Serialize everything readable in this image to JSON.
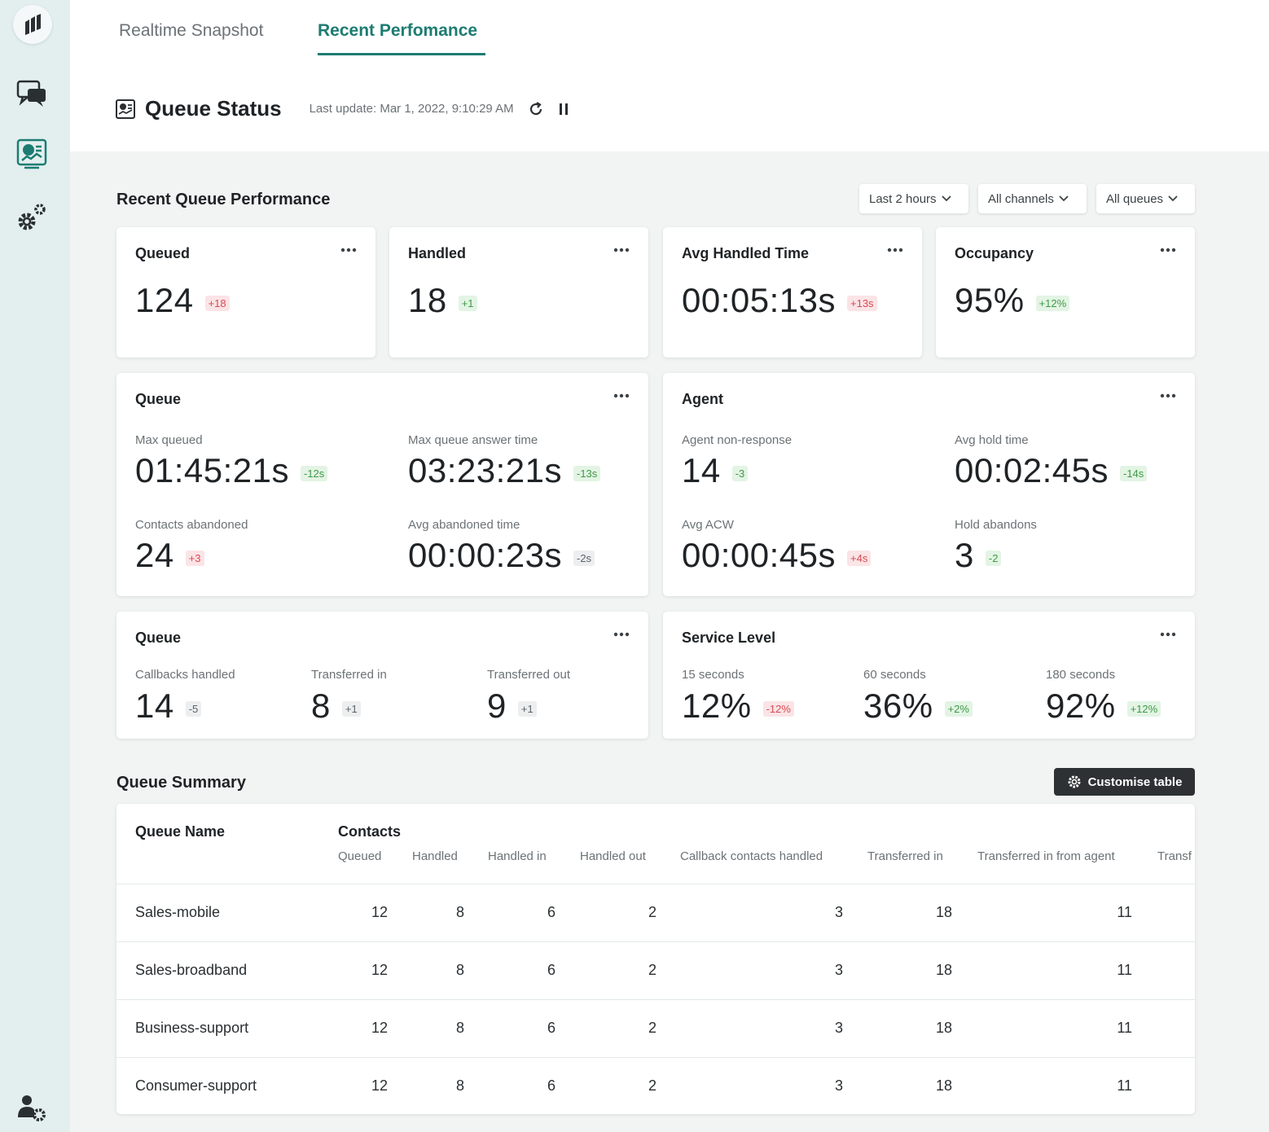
{
  "tabs": [
    {
      "label": "Realtime Snapshot"
    },
    {
      "label": "Recent Perfomance"
    }
  ],
  "header": {
    "title": "Queue Status",
    "last_update": "Last update: Mar 1, 2022, 9:10:29 AM"
  },
  "section_performance": {
    "title": "Recent Queue Performance",
    "filters": [
      "Last 2 hours",
      "All channels",
      "All queues"
    ]
  },
  "kpis": [
    {
      "title": "Queued",
      "value": "124",
      "delta": "+18",
      "tone": "red"
    },
    {
      "title": "Handled",
      "value": "18",
      "delta": "+1",
      "tone": "green"
    },
    {
      "title": "Avg Handled Time",
      "value": "00:05:13s",
      "delta": "+13s",
      "tone": "red"
    },
    {
      "title": "Occupancy",
      "value": "95%",
      "delta": "+12%",
      "tone": "green"
    }
  ],
  "queue_card": {
    "title": "Queue",
    "metrics": [
      {
        "label": "Max queued",
        "value": "01:45:21s",
        "delta": "-12s",
        "tone": "green"
      },
      {
        "label": "Max queue answer time",
        "value": "03:23:21s",
        "delta": "-13s",
        "tone": "green"
      },
      {
        "label": "Contacts abandoned",
        "value": "24",
        "delta": "+3",
        "tone": "red"
      },
      {
        "label": "Avg abandoned time",
        "value": "00:00:23s",
        "delta": "-2s",
        "tone": "gray"
      }
    ]
  },
  "agent_card": {
    "title": "Agent",
    "metrics": [
      {
        "label": "Agent non-response",
        "value": "14",
        "delta": "-3",
        "tone": "green"
      },
      {
        "label": "Avg hold time",
        "value": "00:02:45s",
        "delta": "-14s",
        "tone": "green"
      },
      {
        "label": "Avg ACW",
        "value": "00:00:45s",
        "delta": "+4s",
        "tone": "red"
      },
      {
        "label": "Hold abandons",
        "value": "3",
        "delta": "-2",
        "tone": "green"
      }
    ]
  },
  "queue_card_2": {
    "title": "Queue",
    "metrics": [
      {
        "label": "Callbacks handled",
        "value": "14",
        "delta": "-5",
        "tone": "gray"
      },
      {
        "label": "Transferred in",
        "value": "8",
        "delta": "+1",
        "tone": "gray"
      },
      {
        "label": "Transferred out",
        "value": "9",
        "delta": "+1",
        "tone": "gray"
      }
    ]
  },
  "service_card": {
    "title": "Service Level",
    "metrics": [
      {
        "label": "15 seconds",
        "value": "12%",
        "delta": "-12%",
        "tone": "red"
      },
      {
        "label": "60 seconds",
        "value": "36%",
        "delta": "+2%",
        "tone": "green"
      },
      {
        "label": "180 seconds",
        "value": "92%",
        "delta": "+12%",
        "tone": "green"
      }
    ]
  },
  "summary": {
    "title": "Queue Summary",
    "customise_label": "Customise table",
    "col_name": "Queue Name",
    "col_group": "Contacts",
    "columns": [
      "Queued",
      "Handled",
      "Handled in",
      "Handled out",
      "Callback contacts handled",
      "Transferred in",
      "Transferred in from agent",
      "Transf"
    ],
    "rows": [
      {
        "name": "Sales-mobile",
        "values": [
          "12",
          "8",
          "6",
          "2",
          "3",
          "18",
          "11"
        ]
      },
      {
        "name": "Sales-broadband",
        "values": [
          "12",
          "8",
          "6",
          "2",
          "3",
          "18",
          "11"
        ]
      },
      {
        "name": "Business-support",
        "values": [
          "12",
          "8",
          "6",
          "2",
          "3",
          "18",
          "11"
        ]
      },
      {
        "name": "Consumer-support",
        "values": [
          "12",
          "8",
          "6",
          "2",
          "3",
          "18",
          "11"
        ]
      }
    ]
  },
  "colors": {
    "accent": "#1c7c72",
    "up_bad": "#d94a56",
    "down_good": "#3f9a47"
  },
  "icons": [
    "logo-icon",
    "chat-icon",
    "dashboard-icon",
    "settings-icon",
    "user-settings-icon",
    "refresh-icon",
    "pause-icon",
    "more-icon",
    "chevron-down-icon",
    "gear-icon"
  ]
}
